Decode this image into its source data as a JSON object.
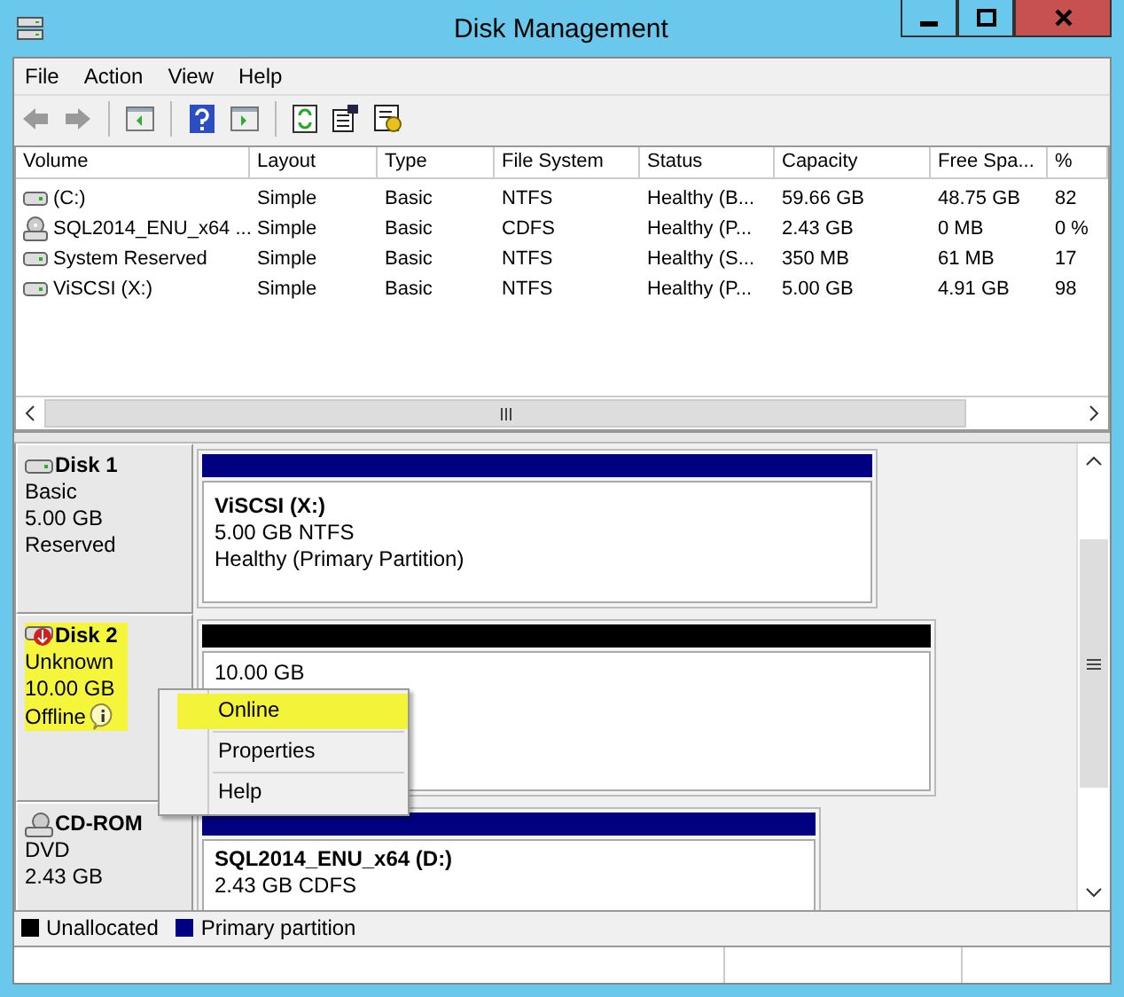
{
  "window": {
    "title": "Disk Management"
  },
  "menu": [
    {
      "label": "File"
    },
    {
      "label": "Action"
    },
    {
      "label": "View"
    },
    {
      "label": "Help"
    }
  ],
  "volumes": {
    "columns": [
      "Volume",
      "Layout",
      "Type",
      "File System",
      "Status",
      "Capacity",
      "Free Spa...",
      "%"
    ],
    "rows": [
      {
        "kind": "drive",
        "cells": [
          "(C:)",
          "Simple",
          "Basic",
          "NTFS",
          "Healthy (B...",
          "59.66 GB",
          "48.75 GB",
          "82"
        ]
      },
      {
        "kind": "cdrom",
        "cells": [
          "SQL2014_ENU_x64 ...",
          "Simple",
          "Basic",
          "CDFS",
          "Healthy (P...",
          "2.43 GB",
          "0 MB",
          "0 %"
        ]
      },
      {
        "kind": "drive",
        "cells": [
          "System Reserved",
          "Simple",
          "Basic",
          "NTFS",
          "Healthy (S...",
          "350 MB",
          "61 MB",
          "17"
        ]
      },
      {
        "kind": "drive",
        "cells": [
          "ViSCSI (X:)",
          "Simple",
          "Basic",
          "NTFS",
          "Healthy (P...",
          "5.00 GB",
          "4.91 GB",
          "98"
        ]
      }
    ]
  },
  "disks": [
    {
      "kind": "disk",
      "name": "Disk 1",
      "lines": [
        "Basic",
        "5.00 GB",
        "Reserved"
      ],
      "highlighted": false,
      "partitions": [
        {
          "kind": "primary",
          "name": "ViSCSI  (X:)",
          "lines": [
            "5.00 GB NTFS",
            "Healthy (Primary Partition)"
          ]
        }
      ]
    },
    {
      "kind": "offline",
      "name": "Disk 2",
      "lines": [
        "Unknown",
        "10.00 GB",
        "Offline"
      ],
      "highlighted": true,
      "partitions": [
        {
          "kind": "unallocated",
          "lines": [
            "10.00 GB"
          ]
        }
      ]
    },
    {
      "kind": "cdrom",
      "name": "CD-ROM",
      "lines": [
        "DVD",
        "2.43 GB"
      ],
      "highlighted": false,
      "partitions": [
        {
          "kind": "primary",
          "name": "SQL2014_ENU_x64  (D:)",
          "lines": [
            "2.43 GB CDFS"
          ]
        }
      ]
    }
  ],
  "context_menu": [
    {
      "label": "Online",
      "selected": true
    },
    {
      "label": "Properties",
      "selected": false
    },
    {
      "label": "Help",
      "selected": false
    }
  ],
  "legend": [
    {
      "label": "Unallocated",
      "color": "#000000"
    },
    {
      "label": "Primary partition",
      "color": "#000080"
    }
  ]
}
